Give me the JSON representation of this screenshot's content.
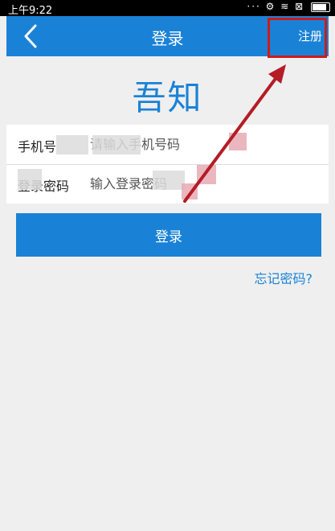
{
  "status_bar": {
    "time": "上午9:22",
    "icons_text": "··· ⚙ ≋ ⊠"
  },
  "navbar": {
    "title": "登录",
    "back_icon": "chevron-left-icon",
    "register_label": "注册"
  },
  "logo_text": "吾知",
  "form": {
    "phone_label": "手机号",
    "phone_placeholder": "请输入手机号码",
    "password_label": "登录密码",
    "password_placeholder": "输入登录密码"
  },
  "login_button_label": "登录",
  "forgot_password_label": "忘记密码?",
  "colors": {
    "accent": "#1a82d6",
    "highlight": "#cc1b1b"
  }
}
